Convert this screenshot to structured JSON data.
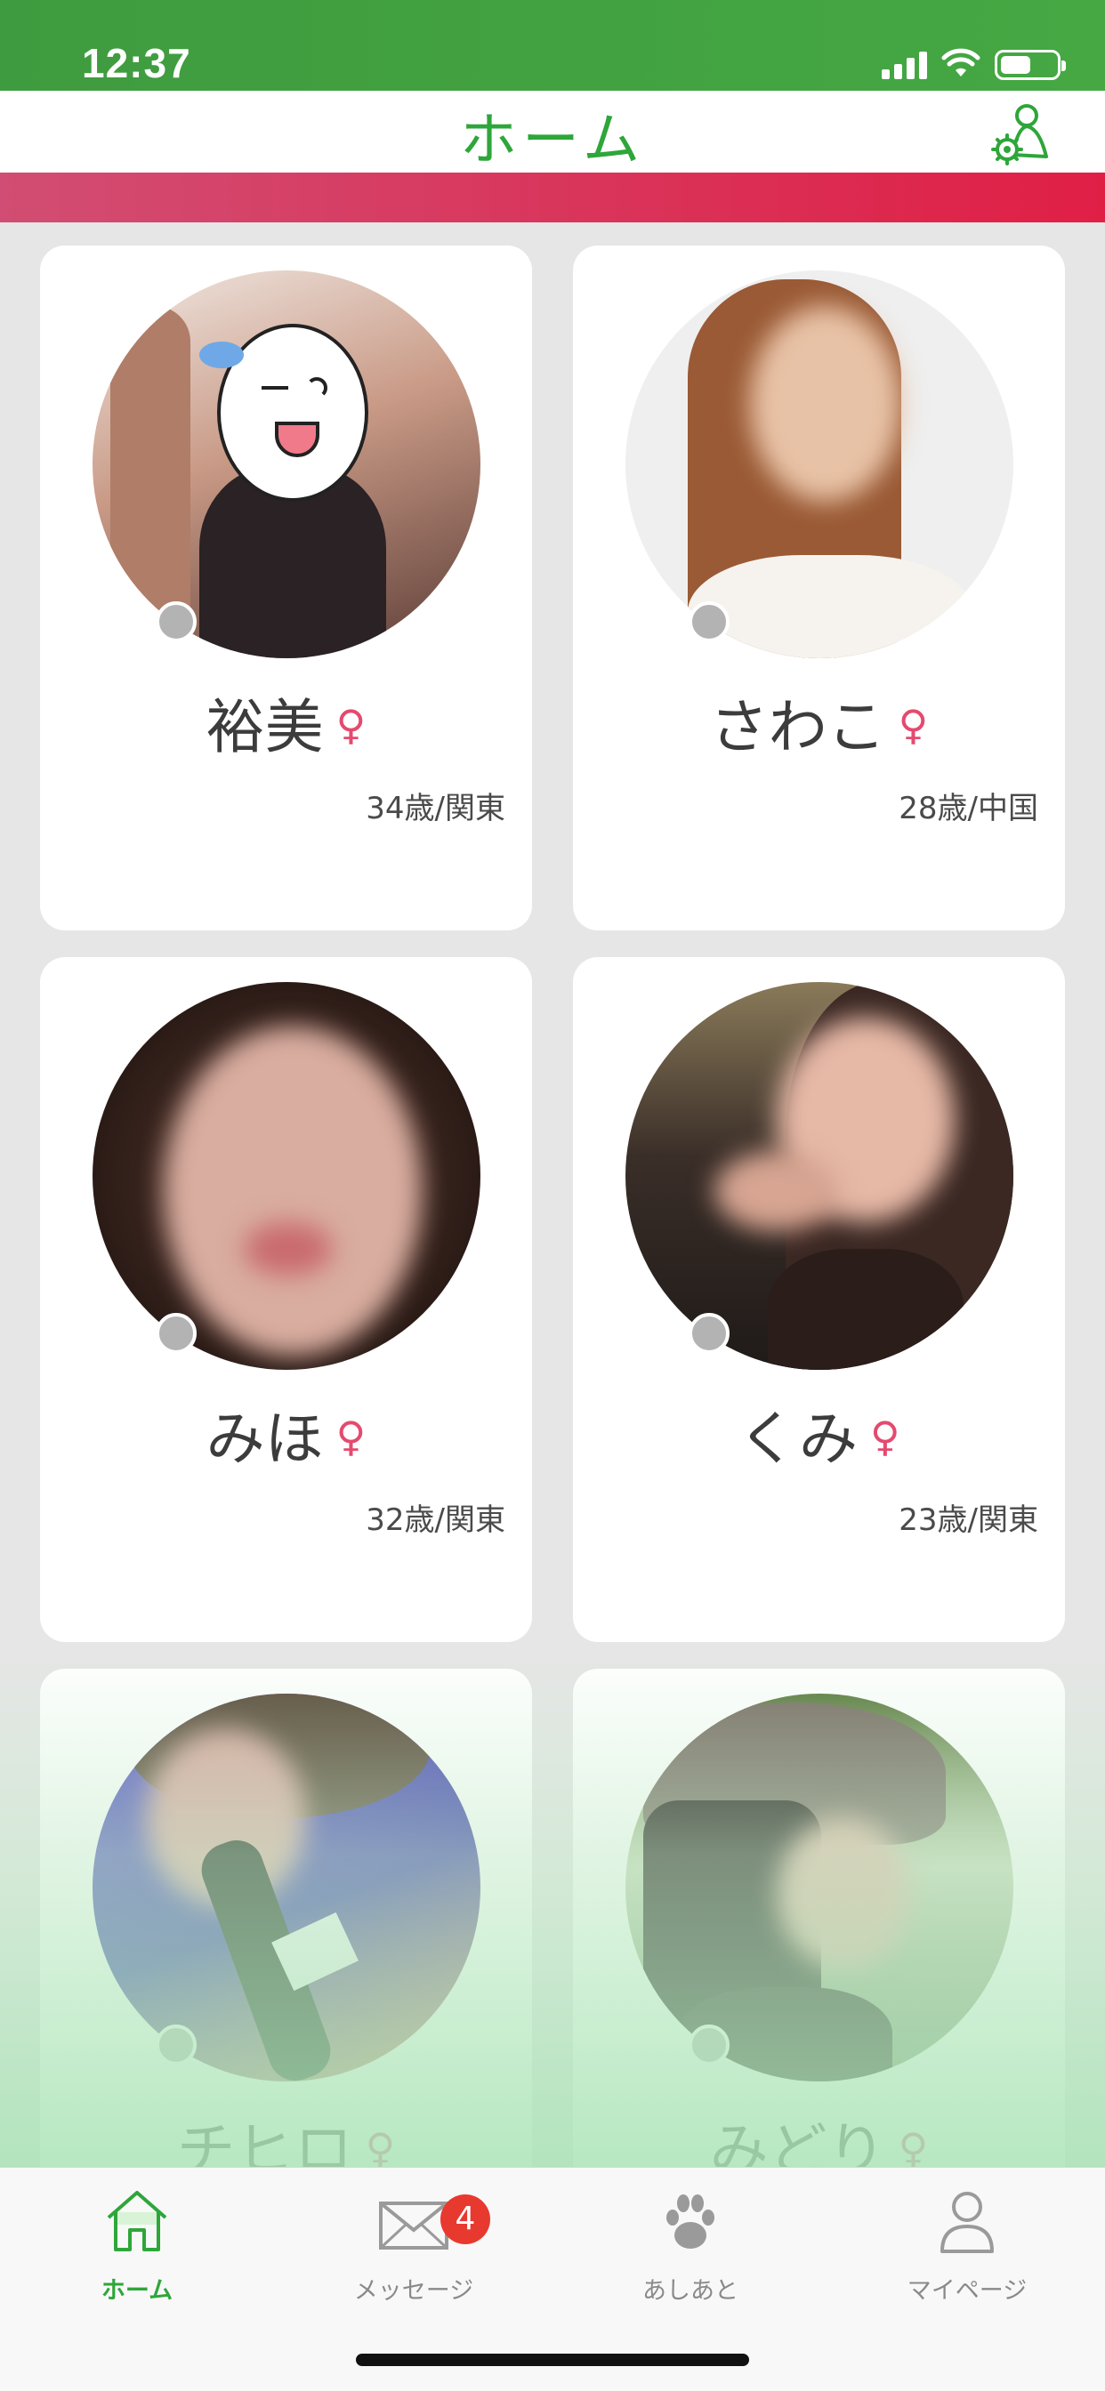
{
  "status_bar": {
    "time": "12:37",
    "icons": [
      "signal-icon",
      "wifi-icon",
      "battery-icon"
    ]
  },
  "header": {
    "title": "ホーム",
    "settings_icon": "settings-person-icon"
  },
  "colors": {
    "brand_green": "#2ea63a",
    "accent_pink": "#e01f45",
    "female": "#e44a6f",
    "badge": "#e8392f",
    "offline_dot": "#b3b3b3"
  },
  "profiles": [
    {
      "name": "裕美",
      "gender_icon": "♀",
      "meta": "34歳/関東"
    },
    {
      "name": "さわこ",
      "gender_icon": "♀",
      "meta": "28歳/中国"
    },
    {
      "name": "みほ",
      "gender_icon": "♀",
      "meta": "32歳/関東"
    },
    {
      "name": "くみ",
      "gender_icon": "♀",
      "meta": "23歳/関東"
    },
    {
      "name": "チヒロ",
      "gender_icon": "♀",
      "meta": ""
    },
    {
      "name": "みどり",
      "gender_icon": "♀",
      "meta": ""
    }
  ],
  "tabs": [
    {
      "label": "ホーム",
      "icon": "home-icon",
      "active": true
    },
    {
      "label": "メッセージ",
      "icon": "mail-icon",
      "badge": "4"
    },
    {
      "label": "あしあと",
      "icon": "paw-icon"
    },
    {
      "label": "マイページ",
      "icon": "person-icon"
    }
  ]
}
